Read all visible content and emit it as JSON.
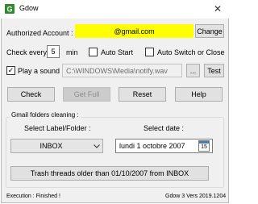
{
  "window": {
    "title": "Gdow",
    "close_glyph": "✕",
    "app_icon": "gdow-logo-icon",
    "icon_color": "#2e8b2e"
  },
  "account": {
    "label": "Authorized Account :",
    "value": "@gmail.com",
    "highlight_color": "#ffff00",
    "change_label": "Change"
  },
  "check": {
    "prefix": "Check every",
    "interval": "5",
    "unit": "min",
    "auto_start_label": "Auto Start",
    "auto_start_checked": false,
    "auto_switch_label": "Auto Switch or Close",
    "auto_switch_checked": false
  },
  "sound": {
    "label": "Play a sound",
    "checked": true,
    "path": "C:\\WINDOWS\\Media\\notify.wav",
    "browse_label": "...",
    "test_label": "Test"
  },
  "actions": {
    "check_label": "Check",
    "get_full_label": "Get Full",
    "reset_label": "Reset",
    "help_label": "Help"
  },
  "cleaning": {
    "group_title": "Gmail folders cleaning :",
    "label_title": "Select Label/Folder :",
    "label_value": "INBOX",
    "date_title": "Select date :",
    "date_value": "lundi 1 octobre 2007",
    "calendar_day": "15",
    "trash_label": "Trash threads older than 01/10/2007 from INBOX"
  },
  "status": {
    "execution": "Execution :  Finished !",
    "version": "Gdow 3 Vers 2019.1204"
  }
}
